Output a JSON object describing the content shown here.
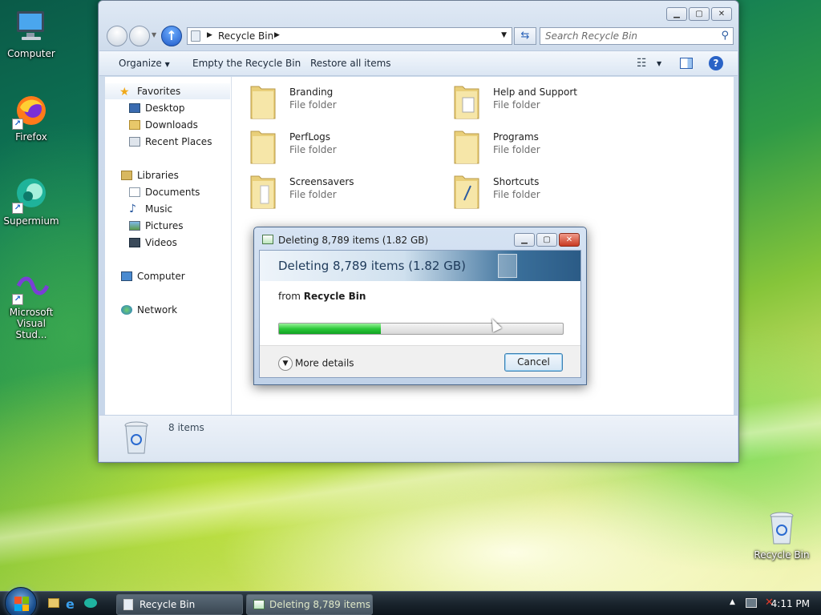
{
  "desktop": {
    "icons": [
      {
        "label": "Computer"
      },
      {
        "label": "Firefox"
      },
      {
        "label": "Supermium"
      },
      {
        "label": "Microsoft Visual Stud..."
      },
      {
        "label": "Recycle Bin"
      }
    ]
  },
  "explorer": {
    "address": "Recycle Bin",
    "search_placeholder": "Search Recycle Bin",
    "toolbar": {
      "organize": "Organize",
      "empty": "Empty the Recycle Bin",
      "restore": "Restore all items"
    },
    "nav": {
      "favorites": "Favorites",
      "desktop": "Desktop",
      "downloads": "Downloads",
      "recent": "Recent Places",
      "libraries": "Libraries",
      "documents": "Documents",
      "music": "Music",
      "pictures": "Pictures",
      "videos": "Videos",
      "computer": "Computer",
      "network": "Network"
    },
    "items": [
      {
        "name": "Branding",
        "type": "File folder"
      },
      {
        "name": "Help and Support",
        "type": "File folder"
      },
      {
        "name": "PerfLogs",
        "type": "File folder"
      },
      {
        "name": "Programs",
        "type": "File folder"
      },
      {
        "name": "Screensavers",
        "type": "File folder"
      },
      {
        "name": "Shortcuts",
        "type": "File folder"
      }
    ],
    "details": "8 items"
  },
  "dialog": {
    "title": "Deleting 8,789 items (1.82 GB)",
    "heading": "Deleting 8,789 items (1.82 GB)",
    "from_label": "from",
    "from_value": "Recycle Bin",
    "progress": 0.36,
    "more": "More details",
    "cancel": "Cancel"
  },
  "taskbar": {
    "recycle": "Recycle Bin",
    "deleting": "Deleting 8,789 items ...",
    "clock": "4:11 PM"
  },
  "colors": {
    "progress_fill": "#2cc93a",
    "accent": "#1e58c8"
  }
}
